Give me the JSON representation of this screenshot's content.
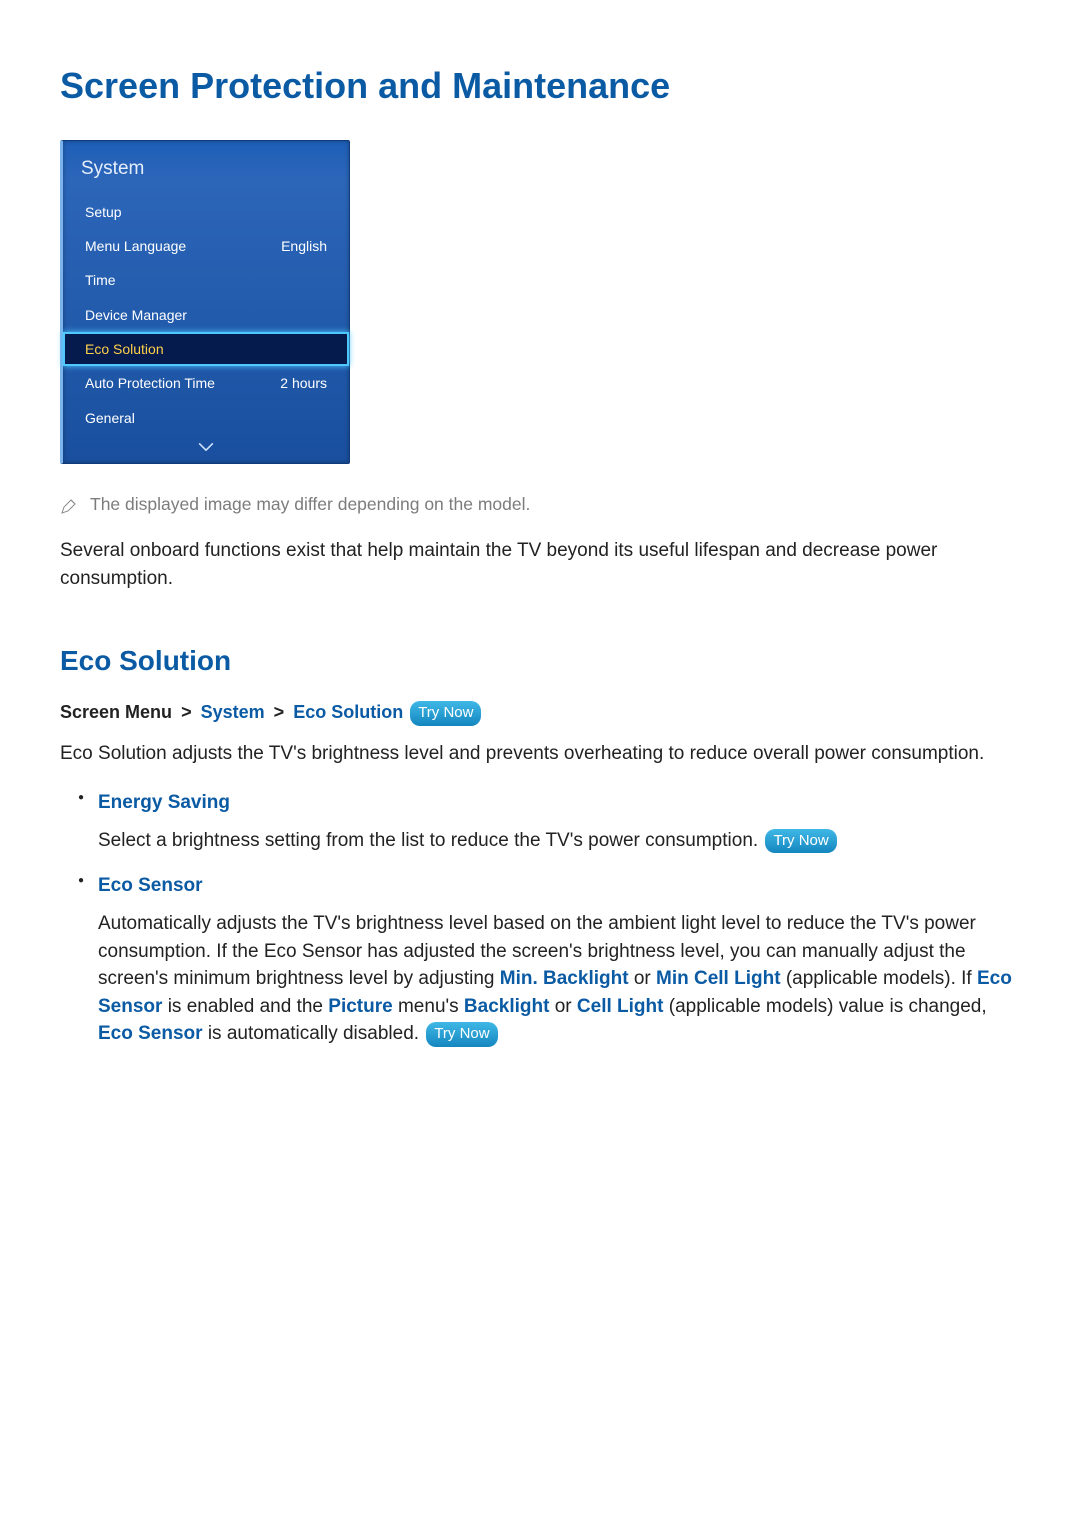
{
  "page_title": "Screen Protection and Maintenance",
  "menu": {
    "heading": "System",
    "rows": [
      {
        "label": "Setup",
        "value": ""
      },
      {
        "label": "Menu Language",
        "value": "English"
      },
      {
        "label": "Time",
        "value": ""
      },
      {
        "label": "Device Manager",
        "value": ""
      },
      {
        "label": "Eco Solution",
        "value": "",
        "selected": true
      },
      {
        "label": "Auto Protection Time",
        "value": "2 hours"
      },
      {
        "label": "General",
        "value": ""
      }
    ]
  },
  "note_text": "The displayed image may differ depending on the model.",
  "intro_paragraph": "Several onboard functions exist that help maintain the TV beyond its useful lifespan and decrease power consumption.",
  "section": {
    "title": "Eco Solution",
    "breadcrumb": {
      "root": "Screen Menu",
      "path": [
        "System",
        "Eco Solution"
      ],
      "try_now": "Try Now"
    },
    "paragraph": "Eco Solution adjusts the TV's brightness level and prevents overheating to reduce overall power consumption.",
    "features": [
      {
        "name": "Energy Saving",
        "desc_plain": "Select a brightness setting from the list to reduce the TV's power consumption. ",
        "try_now": "Try Now"
      },
      {
        "name": "Eco Sensor",
        "desc_parts": {
          "p1": "Automatically adjusts the TV's brightness level based on the ambient light level to reduce the TV's power consumption. If the Eco Sensor has adjusted the screen's brightness level, you can manually adjust the screen's minimum brightness level by adjusting ",
          "kw1": "Min. Backlight",
          "p2": " or ",
          "kw2": "Min Cell Light",
          "p3": " (applicable models). If ",
          "kw3": "Eco Sensor",
          "p4": " is enabled and the ",
          "kw4": "Picture",
          "p5": " menu's ",
          "kw5": "Backlight",
          "p6": " or ",
          "kw6": "Cell Light",
          "p7": " (applicable models) value is changed, ",
          "kw7": "Eco Sensor",
          "p8": " is automatically disabled. "
        },
        "try_now": "Try Now"
      }
    ]
  }
}
